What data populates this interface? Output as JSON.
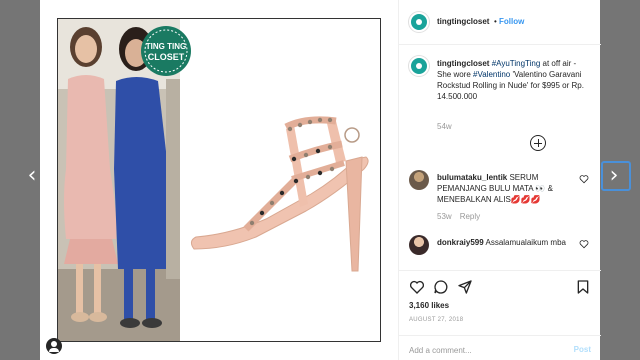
{
  "header": {
    "username": "tingtingcloset",
    "separator": "•",
    "follow_label": "Follow"
  },
  "logo": {
    "line1": "TING TING",
    "line2": "CLOSET"
  },
  "caption": {
    "username": "tingtingcloset",
    "hashtag": "#AyuTingTing",
    "text_after_hashtag": " at off air -",
    "line2_prefix": "She wore ",
    "line2_hashtag": "#Valentino",
    "line2_rest": " 'Valentino Garavani Rockstud Rolling in Nude' for $995 or Rp. 14.500.000",
    "age": "54w"
  },
  "comments": [
    {
      "username": "bulumataku_lentik",
      "text": " SERUM PEMANJANG BULU MATA 👀 & MENEBALKAN ALIS",
      "emoji_tail": "💋💋💋",
      "age": "53w",
      "reply_label": "Reply"
    },
    {
      "username": "donkraiy599",
      "text": " Assalamualaikum mba"
    }
  ],
  "actions": {
    "likes": "3,160 likes",
    "date": "AUGUST 27, 2018"
  },
  "comment_box": {
    "placeholder": "Add a comment...",
    "post_label": "Post"
  },
  "icons": {
    "prev": "chevron-left-icon",
    "next": "chevron-right-icon",
    "like": "heart-icon",
    "comment": "speech-bubble-icon",
    "share": "share-icon",
    "save": "bookmark-icon"
  },
  "colors": {
    "link_blue": "#3897f0",
    "hashtag_blue": "#003569",
    "brand_teal": "#1aa39a",
    "post_disabled": "#b2dffc"
  }
}
